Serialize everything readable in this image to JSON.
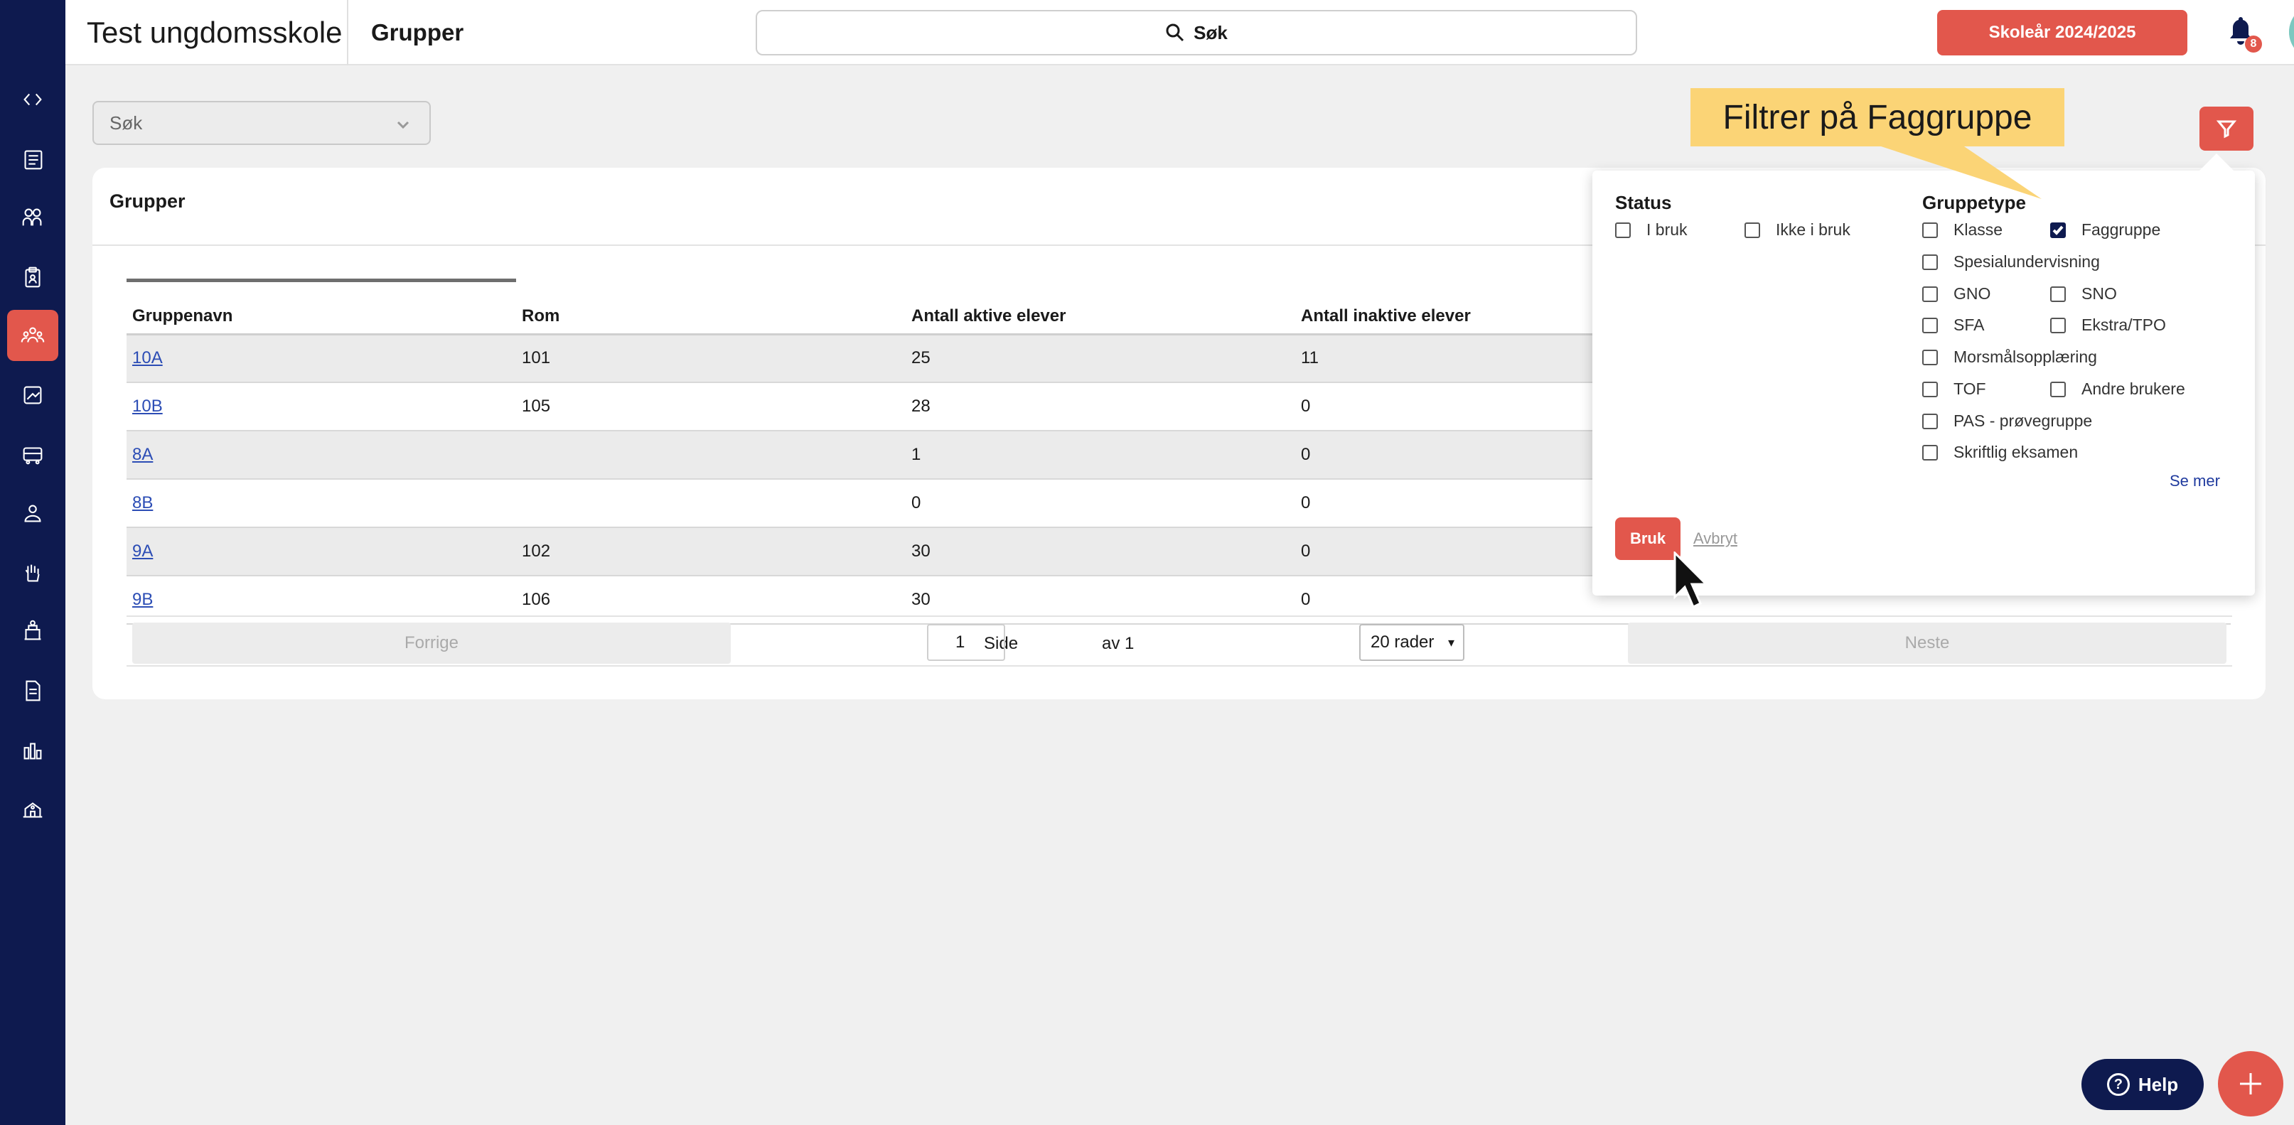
{
  "header": {
    "app_title": "Test ungdomsskole",
    "page_title": "Grupper",
    "search_label": "Søk",
    "school_year": "Skoleår 2024/2025",
    "notification_count": "8"
  },
  "toolbar": {
    "filter_placeholder": "Søk"
  },
  "card": {
    "title": "Grupper",
    "columns": [
      "Gruppenavn",
      "Rom",
      "Antall aktive elever",
      "Antall inaktive elever"
    ],
    "rows": [
      {
        "name": "10A",
        "room": "101",
        "active": "25",
        "inactive": "11"
      },
      {
        "name": "10B",
        "room": "105",
        "active": "28",
        "inactive": "0"
      },
      {
        "name": "8A",
        "room": "",
        "active": "1",
        "inactive": "0"
      },
      {
        "name": "8B",
        "room": "",
        "active": "0",
        "inactive": "0"
      },
      {
        "name": "9A",
        "room": "102",
        "active": "30",
        "inactive": "0"
      },
      {
        "name": "9B",
        "room": "106",
        "active": "30",
        "inactive": "0"
      }
    ]
  },
  "pager": {
    "prev": "Forrige",
    "next": "Neste",
    "side_label": "Side",
    "page": "1",
    "of_label": "av 1",
    "rows_per_page": "20 rader"
  },
  "filter_popover": {
    "status_heading": "Status",
    "status_options": {
      "in_use": "I bruk",
      "not_in_use": "Ikke i bruk"
    },
    "type_heading": "Gruppetype",
    "type_options": {
      "klasse": "Klasse",
      "faggruppe": "Faggruppe",
      "spesial": "Spesialundervisning",
      "gno": "GNO",
      "sno": "SNO",
      "sfa": "SFA",
      "ekstra": "Ekstra/TPO",
      "morsmal": "Morsmålsopplæring",
      "tof": "TOF",
      "andre": "Andre brukere",
      "pas": "PAS - prøvegruppe",
      "skriftlig": "Skriftlig eksamen"
    },
    "faggruppe_checked": true,
    "see_more": "Se mer",
    "apply": "Bruk",
    "cancel": "Avbryt"
  },
  "callout": {
    "text": "Filtrer på Faggruppe"
  },
  "help": {
    "label": "Help"
  },
  "colors": {
    "sidebar": "#0e1a4f",
    "accent": "#e2574c",
    "callout": "#fbd476",
    "link": "#2c4db5"
  },
  "sidebar": {
    "icons": [
      "expand-collapse-icon",
      "news-icon",
      "users-icon",
      "clipboard-icon",
      "groups-icon",
      "puzzle-icon",
      "school-bus-icon",
      "person-icon",
      "hand-icon",
      "building-icon",
      "document-icon",
      "chart-icon",
      "school-icon"
    ],
    "active": "groups-icon"
  }
}
